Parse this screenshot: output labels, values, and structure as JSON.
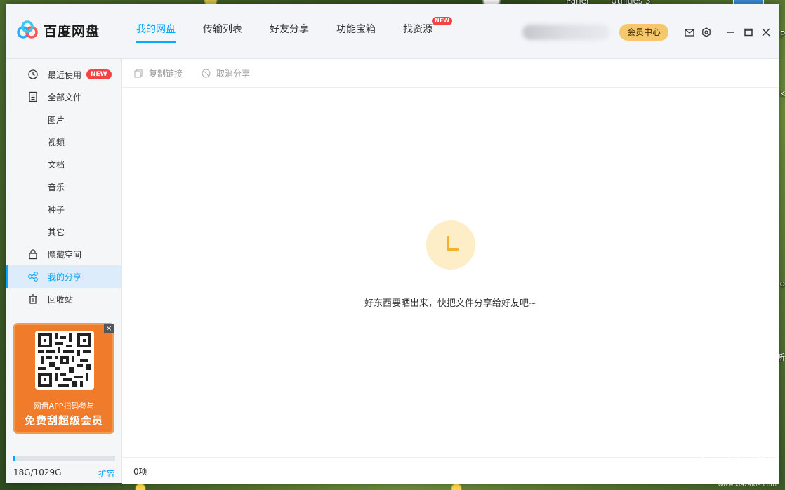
{
  "desktop": {
    "label_left": "Panel",
    "label_right": "Utilities 3",
    "edge_chars": [
      "P",
      "k",
      "o",
      "新"
    ]
  },
  "app": {
    "name": "百度网盘"
  },
  "nav": {
    "tabs": [
      {
        "label": "我的网盘"
      },
      {
        "label": "传输列表"
      },
      {
        "label": "好友分享"
      },
      {
        "label": "功能宝箱"
      },
      {
        "label": "找资源",
        "badge": "NEW"
      }
    ]
  },
  "header": {
    "vip_label": "会员中心"
  },
  "sidebar": {
    "items": [
      {
        "label": "最近使用",
        "badge": "NEW",
        "icon": "clock-icon"
      },
      {
        "label": "全部文件",
        "icon": "document-icon"
      },
      {
        "label": "图片"
      },
      {
        "label": "视频"
      },
      {
        "label": "文档"
      },
      {
        "label": "音乐"
      },
      {
        "label": "种子"
      },
      {
        "label": "其它"
      },
      {
        "label": "隐藏空间",
        "icon": "lock-icon"
      },
      {
        "label": "我的分享",
        "icon": "share-icon"
      },
      {
        "label": "回收站",
        "icon": "trash-icon"
      }
    ],
    "promo": {
      "line1": "网盘APP扫码参与",
      "line2": "免费刮超级会员",
      "close": "×"
    },
    "storage": {
      "used_text": "18G/1029G",
      "used_fraction": 0.0175,
      "expand_label": "扩容"
    }
  },
  "toolbar": {
    "copy_link": "复制链接",
    "cancel_share": "取消分享"
  },
  "main": {
    "empty_message": "好东西要晒出来，快把文件分享给好友吧~"
  },
  "status": {
    "count": "0项"
  },
  "watermark": {
    "text": "下载吧",
    "url": "www.xiazaiba.com"
  },
  "colors": {
    "accent": "#06a7ff",
    "badge": "#f54343",
    "vip": "#f5c96b",
    "promo": "#f07b2a",
    "empty_icon": "#fdeec8",
    "empty_icon_glyph": "#f4b228"
  }
}
